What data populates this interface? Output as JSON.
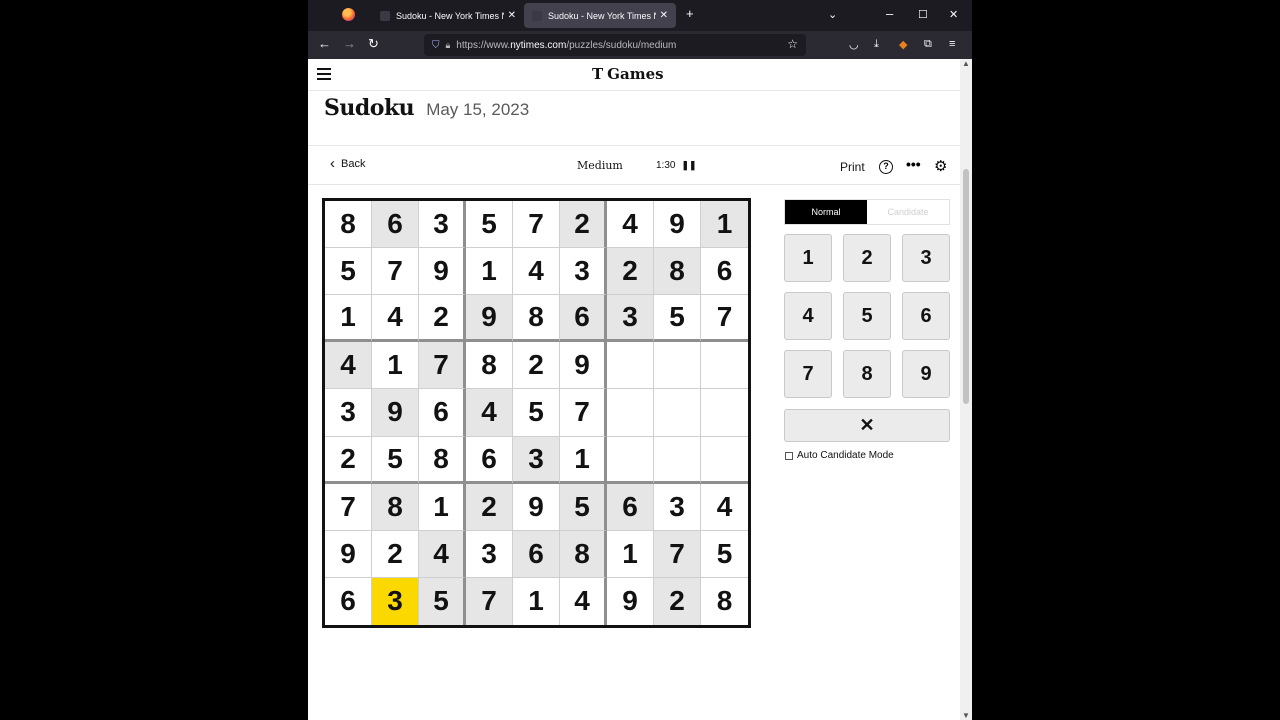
{
  "browser": {
    "tabs": [
      {
        "title": "Sudoku - New York Times Num",
        "active": false
      },
      {
        "title": "Sudoku - New York Times Num",
        "active": true
      }
    ],
    "url": {
      "prefix": "https://www.",
      "domain": "nytimes.com",
      "path": "/puzzles/sudoku/medium"
    }
  },
  "site": {
    "logo_mark": "T",
    "logo_text": "Games"
  },
  "puzzle": {
    "title": "Sudoku",
    "date": "May 15, 2023"
  },
  "toolbar": {
    "back": "Back",
    "difficulty": "Medium",
    "timer": "1:30",
    "print": "Print",
    "help": "?"
  },
  "grid": [
    [
      "8",
      "6",
      "3",
      "5",
      "7",
      "2",
      "4",
      "9",
      "1"
    ],
    [
      "5",
      "7",
      "9",
      "1",
      "4",
      "3",
      "2",
      "8",
      "6"
    ],
    [
      "1",
      "4",
      "2",
      "9",
      "8",
      "6",
      "3",
      "5",
      "7"
    ],
    [
      "4",
      "1",
      "7",
      "8",
      "2",
      "9",
      "",
      "",
      ""
    ],
    [
      "3",
      "9",
      "6",
      "4",
      "5",
      "7",
      "",
      "",
      ""
    ],
    [
      "2",
      "5",
      "8",
      "6",
      "3",
      "1",
      "",
      "",
      ""
    ],
    [
      "7",
      "8",
      "1",
      "2",
      "9",
      "5",
      "6",
      "3",
      "4"
    ],
    [
      "9",
      "2",
      "4",
      "3",
      "6",
      "8",
      "1",
      "7",
      "5"
    ],
    [
      "6",
      "3",
      "5",
      "7",
      "1",
      "4",
      "9",
      "2",
      "8"
    ]
  ],
  "shaded_cells": [
    [
      0,
      1
    ],
    [
      0,
      5
    ],
    [
      0,
      8
    ],
    [
      1,
      6
    ],
    [
      1,
      7
    ],
    [
      2,
      3
    ],
    [
      2,
      5
    ],
    [
      2,
      6
    ],
    [
      3,
      0
    ],
    [
      3,
      2
    ],
    [
      4,
      1
    ],
    [
      4,
      3
    ],
    [
      5,
      4
    ],
    [
      6,
      1
    ],
    [
      6,
      3
    ],
    [
      6,
      5
    ],
    [
      6,
      6
    ],
    [
      7,
      2
    ],
    [
      7,
      4
    ],
    [
      7,
      5
    ],
    [
      7,
      7
    ],
    [
      8,
      2
    ],
    [
      8,
      3
    ],
    [
      8,
      7
    ]
  ],
  "selected_cell": [
    8,
    1
  ],
  "colors": {
    "selected": "#fad800",
    "shaded": "#e6e6e6"
  },
  "modes": {
    "normal": "Normal",
    "candidate": "Candidate"
  },
  "keypad": [
    "1",
    "2",
    "3",
    "4",
    "5",
    "6",
    "7",
    "8",
    "9"
  ],
  "erase": "✕",
  "auto_candidate_label": "Auto Candidate Mode"
}
